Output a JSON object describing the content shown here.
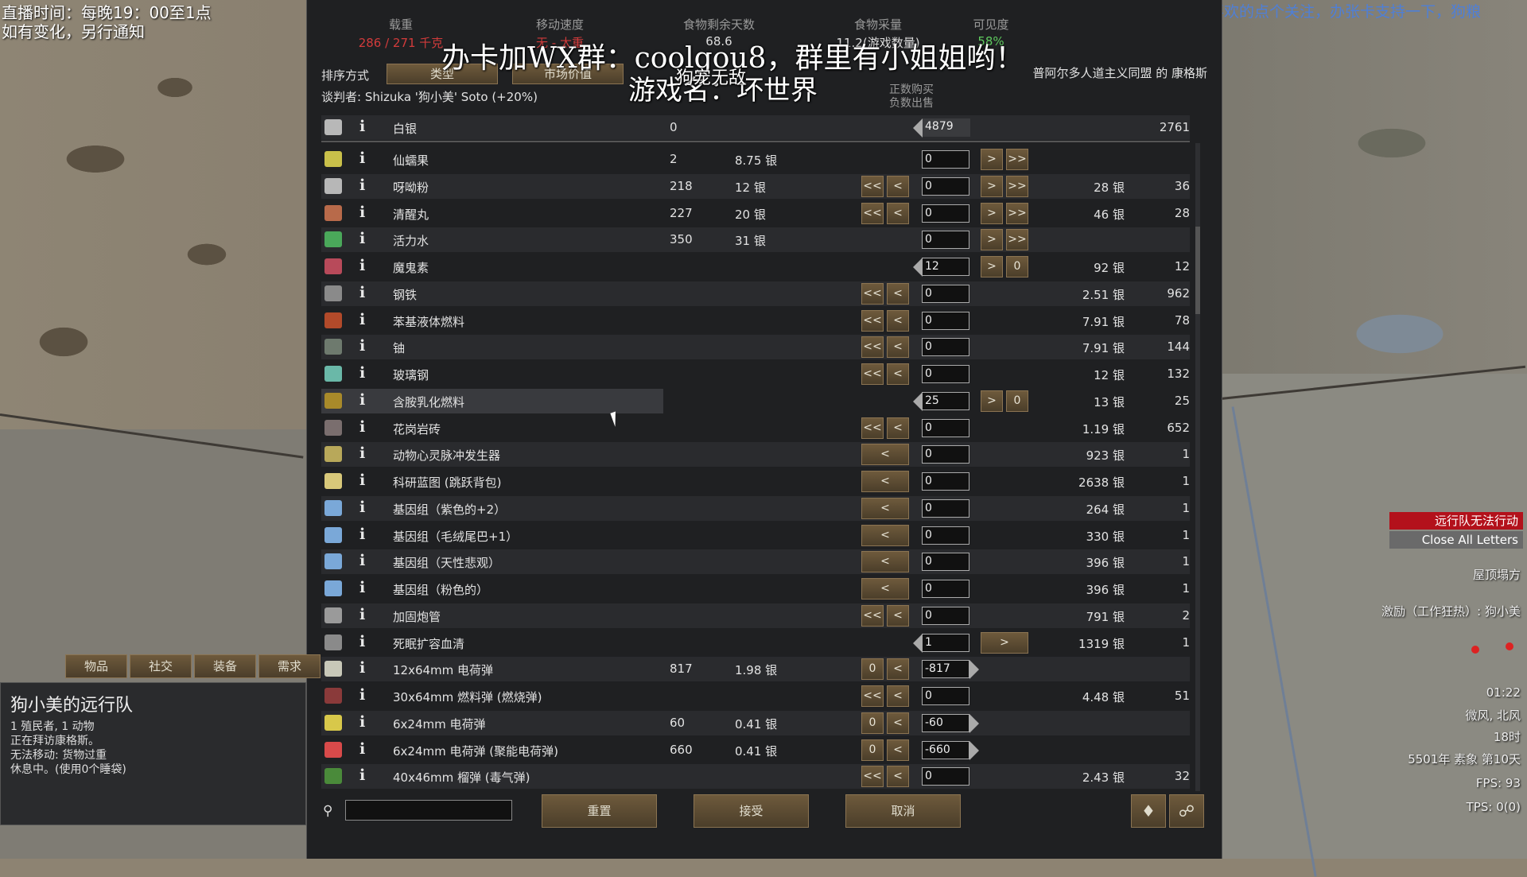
{
  "stream": {
    "line1": "直播时间：每晚19：00至1点",
    "line2": "如有变化，另行通知",
    "top_right": "新人主播，喜欢的点个关注，办张卡支持一下，狗粮"
  },
  "overlay": {
    "ad": "办卡加WX群：coolgou8，群里有小姐姐哟！",
    "player": "游戏名：坏世界",
    "nick": "狗宠无敌"
  },
  "stats": [
    {
      "label": "载重",
      "value": "286 / 271 千克",
      "color": "#d23b3b"
    },
    {
      "label": "移动速度",
      "value": "无 - 太重",
      "color": "#d23b3b"
    },
    {
      "label": "食物剩余天数",
      "value": "68.6",
      "color": "#dddddd"
    },
    {
      "label": "食物采量",
      "value": "11.2(游戏数量)",
      "color": "#dddddd"
    },
    {
      "label": "可见度",
      "value": "58%",
      "color": "#5ec95e"
    }
  ],
  "sort": {
    "label": "排序方式",
    "btn1": "类型",
    "btn2": "市场价值"
  },
  "negotiator": "谈判者: Shizuka '狗小美' Soto (+20%)",
  "trader": "普阿尔多人道主义同盟 的 康格斯",
  "col_headers": {
    "buy": "正数购买",
    "sell": "负数出售"
  },
  "silver": {
    "name": "白银",
    "count": "0",
    "value": "4879",
    "trader_qty": "2761"
  },
  "rows": [
    {
      "name": "仙蠕果",
      "count": "2",
      "price": "8.75 银",
      "left": "",
      "field": "0",
      "right": ">|>>",
      "tprice": "",
      "tqty": "",
      "color": "#c9c04a"
    },
    {
      "name": "呀呦粉",
      "count": "218",
      "price": "12 银",
      "left": "<<|<",
      "field": "0",
      "right": ">|>>",
      "tprice": "28 银",
      "tqty": "36",
      "color": "#b7b7b7"
    },
    {
      "name": "清醒丸",
      "count": "227",
      "price": "20 银",
      "left": "<<|<",
      "field": "0",
      "right": ">|>>",
      "tprice": "46 银",
      "tqty": "28",
      "color": "#b86a4a"
    },
    {
      "name": "活力水",
      "count": "350",
      "price": "31 银",
      "left": "",
      "field": "0",
      "right": ">|>>",
      "tprice": "",
      "tqty": "",
      "color": "#4aa85a"
    },
    {
      "name": "魔鬼素",
      "count": "",
      "price": "",
      "left": "",
      "field": "12",
      "right": ">|0",
      "tprice": "92 银",
      "tqty": "12",
      "color": "#b84a5a",
      "arrowl": true
    },
    {
      "name": "钢铁",
      "count": "",
      "price": "",
      "left": "<<|<",
      "field": "0",
      "right": "",
      "tprice": "2.51 银",
      "tqty": "962",
      "color": "#8a8a8a"
    },
    {
      "name": "苯基液体燃料",
      "count": "",
      "price": "",
      "left": "<<|<",
      "field": "0",
      "right": "",
      "tprice": "7.91 银",
      "tqty": "78",
      "color": "#b24a2a"
    },
    {
      "name": "铀",
      "count": "",
      "price": "",
      "left": "<<|<",
      "field": "0",
      "right": "",
      "tprice": "7.91 银",
      "tqty": "144",
      "color": "#6e7a6e"
    },
    {
      "name": "玻璃钢",
      "count": "",
      "price": "",
      "left": "<<|<",
      "field": "0",
      "right": "",
      "tprice": "12 银",
      "tqty": "132",
      "color": "#6ab8a8"
    },
    {
      "name": "含胺乳化燃料",
      "count": "",
      "price": "",
      "left": "",
      "field": "25",
      "right": ">|0",
      "tprice": "13 银",
      "tqty": "25",
      "color": "#a88a2a",
      "arrowl": true,
      "hl": true
    },
    {
      "name": "花岗岩砖",
      "count": "",
      "price": "",
      "left": "<<|<",
      "field": "0",
      "right": "",
      "tprice": "1.19 银",
      "tqty": "652",
      "color": "#7a6e6e"
    },
    {
      "name": "动物心灵脉冲发生器",
      "count": "",
      "price": "",
      "left": "<",
      "field": "0",
      "right": "",
      "tprice": "923 银",
      "tqty": "1",
      "color": "#b8a85a"
    },
    {
      "name": "科研蓝图 (跳跃背包)",
      "count": "",
      "price": "",
      "left": "<",
      "field": "0",
      "right": "",
      "tprice": "2638 银",
      "tqty": "1",
      "color": "#d8c87a"
    },
    {
      "name": "基因组（紫色的+2）",
      "count": "",
      "price": "",
      "left": "<",
      "field": "0",
      "right": "",
      "tprice": "264 银",
      "tqty": "1",
      "color": "#7aa8d8"
    },
    {
      "name": "基因组（毛绒尾巴+1）",
      "count": "",
      "price": "",
      "left": "<",
      "field": "0",
      "right": "",
      "tprice": "330 银",
      "tqty": "1",
      "color": "#7aa8d8"
    },
    {
      "name": "基因组（天性悲观）",
      "count": "",
      "price": "",
      "left": "<",
      "field": "0",
      "right": "",
      "tprice": "396 银",
      "tqty": "1",
      "color": "#7aa8d8"
    },
    {
      "name": "基因组（粉色的）",
      "count": "",
      "price": "",
      "left": "<",
      "field": "0",
      "right": "",
      "tprice": "396 银",
      "tqty": "1",
      "color": "#7aa8d8"
    },
    {
      "name": "加固炮管",
      "count": "",
      "price": "",
      "left": "<<|<",
      "field": "0",
      "right": "",
      "tprice": "791 银",
      "tqty": "2",
      "color": "#9a9a9a"
    },
    {
      "name": "死眠扩容血清",
      "count": "",
      "price": "",
      "left": "",
      "field": "1",
      "right": ">",
      "tprice": "1319 银",
      "tqty": "1",
      "color": "#8a8a8a",
      "arrowl": true
    },
    {
      "name": "12x64mm 电荷弹",
      "count": "817",
      "price": "1.98 银",
      "left": "0|<",
      "field": "-817",
      "right": "",
      "tprice": "",
      "tqty": "",
      "color": "#c8c8b8",
      "arrowr": true
    },
    {
      "name": "30x64mm 燃料弹 (燃烧弹)",
      "count": "",
      "price": "",
      "left": "<<|<",
      "field": "0",
      "right": "",
      "tprice": "4.48 银",
      "tqty": "51",
      "color": "#8a3a3a"
    },
    {
      "name": "6x24mm 电荷弹",
      "count": "60",
      "price": "0.41 银",
      "left": "0|<",
      "field": "-60",
      "right": "",
      "tprice": "",
      "tqty": "",
      "color": "#d8c84a",
      "arrowr": true
    },
    {
      "name": "6x24mm 电荷弹 (聚能电荷弹)",
      "count": "660",
      "price": "0.41 银",
      "left": "0|<",
      "field": "-660",
      "right": "",
      "tprice": "",
      "tqty": "",
      "color": "#d84a4a",
      "arrowr": true
    },
    {
      "name": "40x46mm 榴弹 (毒气弹)",
      "count": "",
      "price": "",
      "left": "<<|<",
      "field": "0",
      "right": "",
      "tprice": "2.43 银",
      "tqty": "32",
      "color": "#4a8a3a"
    }
  ],
  "bottom": {
    "reset": "重置",
    "accept": "接受",
    "cancel": "取消",
    "search_placeholder": ""
  },
  "tabs": [
    "物品",
    "社交",
    "装备",
    "需求"
  ],
  "caravan": {
    "title": "狗小美的远行队",
    "line1": "1 殖民者, 1 动物",
    "line2": "正在拜访康格斯。",
    "line3": "无法移动: 货物过重",
    "line4": "休息中。(使用0个睡袋)"
  },
  "right_panel": {
    "alert": "远行队无法行动",
    "close_letters": "Close All Letters",
    "roof": "屋顶塌方",
    "inspire": "激励（工作狂热）: 狗小美",
    "time": "01:22",
    "weather": "微风, 北风",
    "hour": "18时",
    "date": "5501年 素象 第10天",
    "fps": "FPS: 93",
    "tps": "TPS: 0(0)"
  }
}
